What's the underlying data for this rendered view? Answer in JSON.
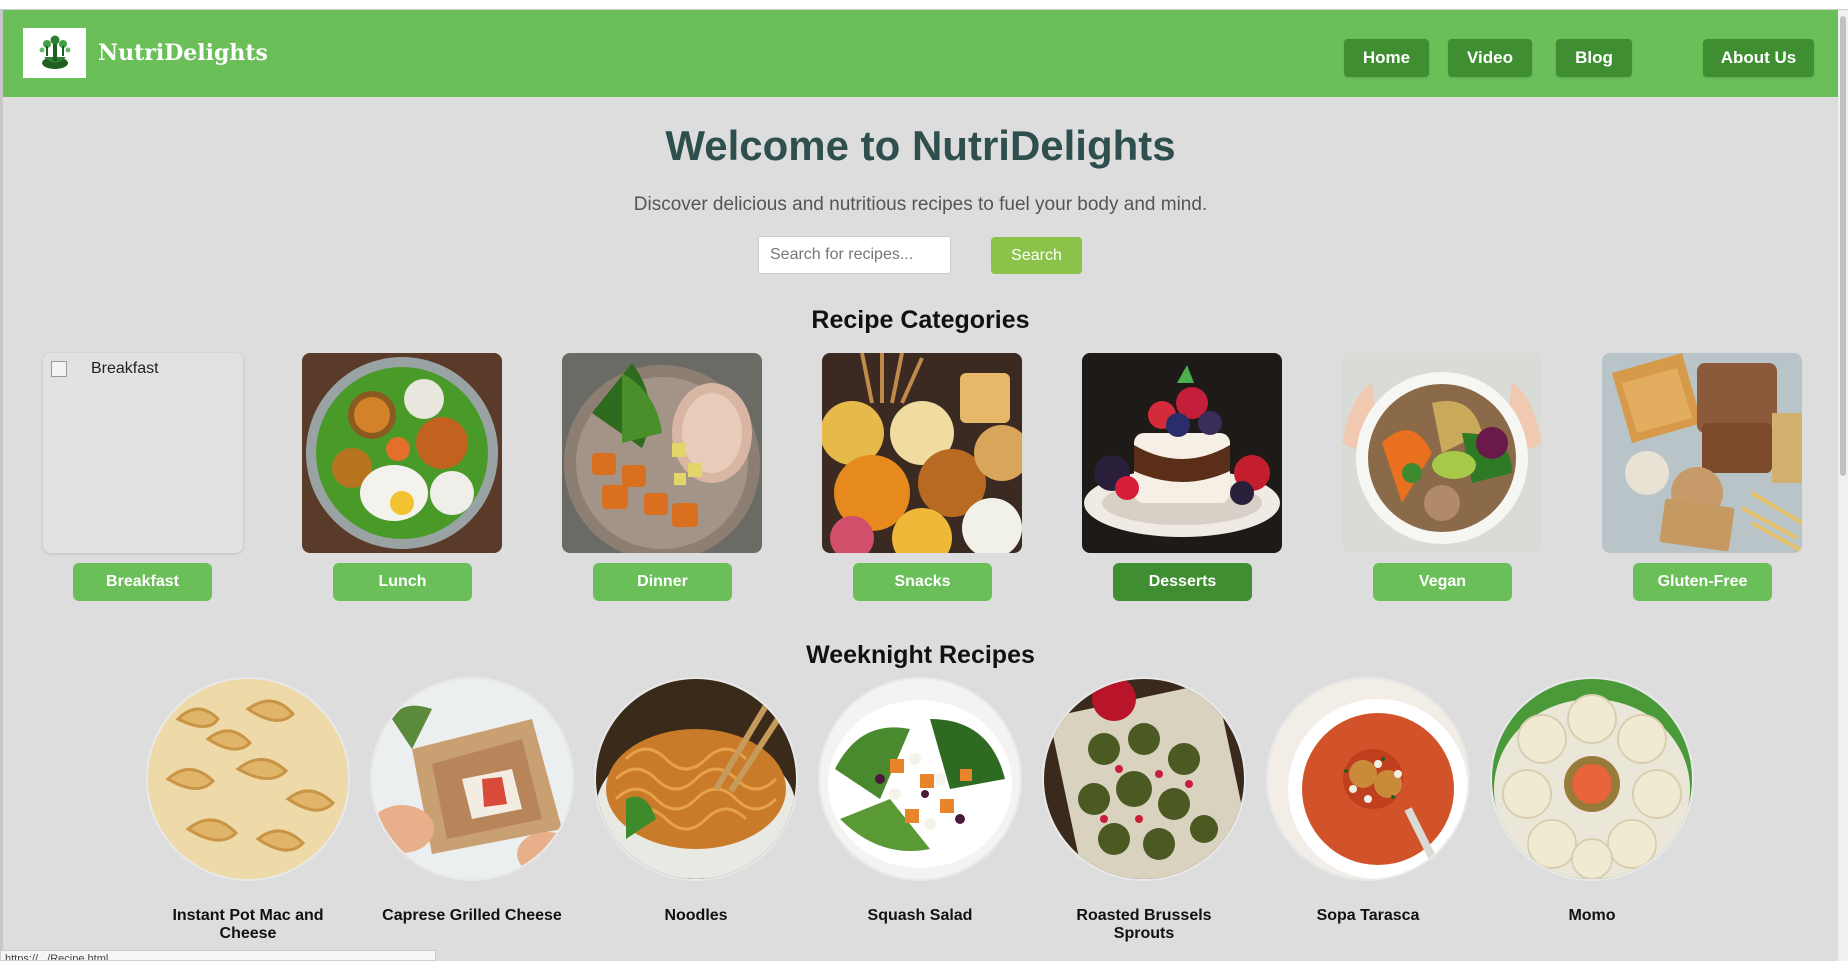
{
  "brand": {
    "name": "NutriDelights",
    "logo_icon": "tree-logo-icon"
  },
  "nav": [
    {
      "label": "Home"
    },
    {
      "label": "Video"
    },
    {
      "label": "Blog"
    },
    {
      "label": "About Us"
    }
  ],
  "hero": {
    "title": "Welcome to NutriDelights",
    "subtitle": "Discover delicious and nutritious recipes to fuel your body and mind."
  },
  "search": {
    "placeholder": "Search for recipes...",
    "button_label": "Search"
  },
  "categories": {
    "title": "Recipe Categories",
    "items": [
      {
        "label": "Breakfast",
        "image_alt": "Breakfast",
        "active": false
      },
      {
        "label": "Lunch",
        "active": false
      },
      {
        "label": "Dinner",
        "active": false
      },
      {
        "label": "Snacks",
        "active": false
      },
      {
        "label": "Desserts",
        "active": true
      },
      {
        "label": "Vegan",
        "active": false
      },
      {
        "label": "Gluten-Free",
        "active": false
      }
    ]
  },
  "weeknight": {
    "title": "Weeknight Recipes",
    "items": [
      {
        "label": "Instant Pot Mac and Cheese"
      },
      {
        "label": "Caprese Grilled Cheese"
      },
      {
        "label": "Noodles"
      },
      {
        "label": "Squash Salad"
      },
      {
        "label": "Roasted Brussels Sprouts"
      },
      {
        "label": "Sopa Tarasca"
      },
      {
        "label": "Momo"
      }
    ]
  },
  "status_url": "https://.../Recipe.html",
  "colors": {
    "navbar": "#6abf59",
    "nav_button": "#3f8f32",
    "search_button": "#8bc34a",
    "title": "#2f4f4f"
  }
}
